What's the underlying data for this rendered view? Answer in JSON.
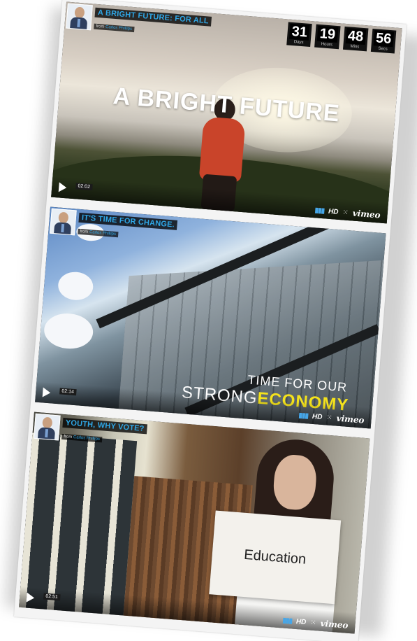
{
  "videos": [
    {
      "title": "A BRIGHT FUTURE: FOR ALL",
      "from_prefix": "from",
      "author": "Carlos Phillips",
      "overlay_text": "A BRIGHT FUTURE",
      "time": "02:02",
      "countdown": [
        {
          "value": "31",
          "label": "Days"
        },
        {
          "value": "19",
          "label": "Hours"
        },
        {
          "value": "48",
          "label": "Mins"
        },
        {
          "value": "56",
          "label": "Secs"
        }
      ]
    },
    {
      "title": "IT'S TIME FOR CHANGE.",
      "from_prefix": "from",
      "author": "Carlos Phillips",
      "overlay_line1": "TIME FOR OUR",
      "overlay_line2_a": "STRONG",
      "overlay_line2_b": "ECONOMY",
      "time": "02:14"
    },
    {
      "title": "YOUTH, WHY VOTE?",
      "from_prefix": "from",
      "author": "Carlos Phillips",
      "sign_text": "Education",
      "time": "02:51"
    }
  ],
  "player": {
    "hd_label": "HD",
    "brand": "vimeo",
    "fullscreen_glyph": "⁙"
  },
  "colors": {
    "accent": "#2fa6e5",
    "economy_yellow": "#f4e21c"
  }
}
